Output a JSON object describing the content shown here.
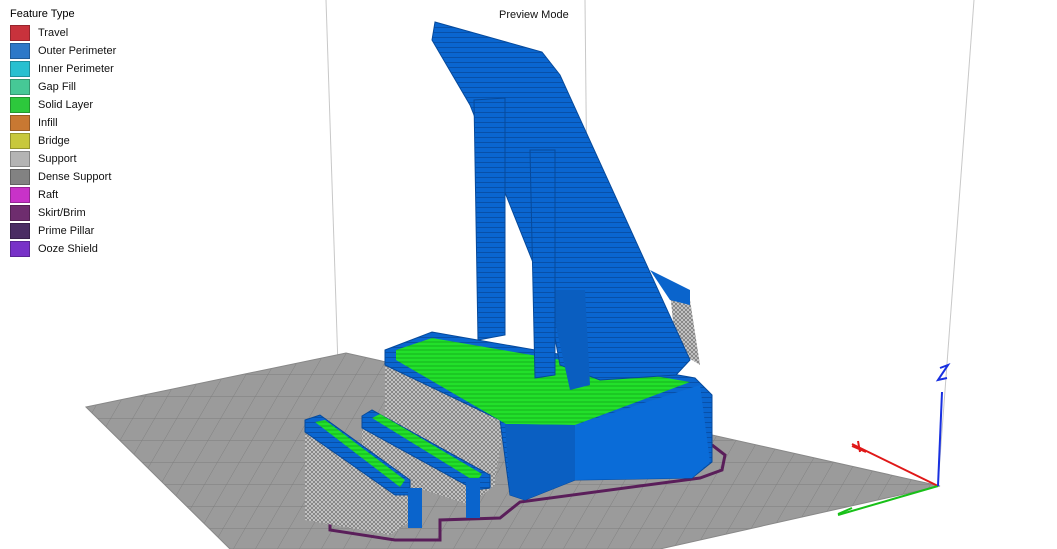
{
  "legend": {
    "title": "Feature Type",
    "items": [
      {
        "label": "Travel",
        "color": "#c8323c"
      },
      {
        "label": "Outer Perimeter",
        "color": "#2d78c8"
      },
      {
        "label": "Inner Perimeter",
        "color": "#28c0d0"
      },
      {
        "label": "Gap Fill",
        "color": "#46c896"
      },
      {
        "label": "Solid Layer",
        "color": "#2dc83c"
      },
      {
        "label": "Infill",
        "color": "#c87832"
      },
      {
        "label": "Bridge",
        "color": "#c8c83c"
      },
      {
        "label": "Support",
        "color": "#b4b4b4"
      },
      {
        "label": "Dense Support",
        "color": "#828282"
      },
      {
        "label": "Raft",
        "color": "#c832c8"
      },
      {
        "label": "Skirt/Brim",
        "color": "#6e2d6e"
      },
      {
        "label": "Prime Pillar",
        "color": "#4b2d64"
      },
      {
        "label": "Ooze Shield",
        "color": "#7832c8"
      }
    ]
  },
  "mode_label": "Preview Mode",
  "colors": {
    "bed": "#9b9b9b",
    "grid": "#7e7e7e",
    "model_blue": "#0a64cc",
    "model_blue_dark": "#064a9c",
    "solid_green": "#1ee628",
    "skirt": "#5a1e5a",
    "axis_x": "#e01818",
    "axis_y": "#18c018",
    "axis_z": "#1830e0"
  }
}
